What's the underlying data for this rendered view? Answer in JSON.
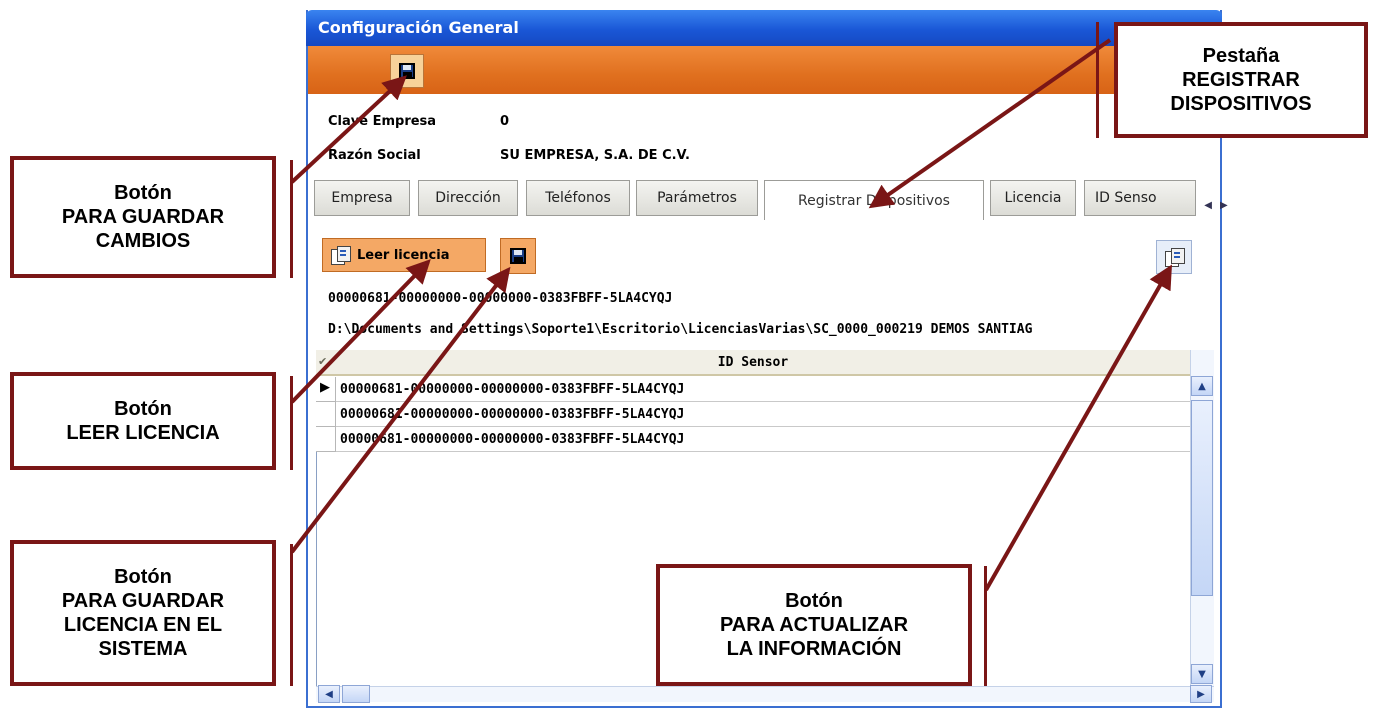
{
  "window": {
    "title": "Configuración General"
  },
  "toolbar": {
    "save_icon": "floppy-disk-icon"
  },
  "company": {
    "clave_label": "Clave Empresa",
    "clave_value": "0",
    "razon_label": "Razón Social",
    "razon_value": "SU EMPRESA, S.A. DE C.V."
  },
  "tabs": [
    {
      "label": "Empresa"
    },
    {
      "label": "Dirección"
    },
    {
      "label": "Teléfonos"
    },
    {
      "label": "Parámetros"
    },
    {
      "label": "Registrar Dispositivos"
    },
    {
      "label": "Licencia"
    },
    {
      "label": "ID Senso"
    }
  ],
  "actions": {
    "leer_licencia_label": "Leer licencia"
  },
  "license": {
    "key": "00000681-00000000-00000000-0383FBFF-5LA4CYQJ",
    "path": "D:\\Documents and Settings\\Soporte1\\Escritorio\\LicenciasVarias\\SC_0000_000219 DEMOS SANTIAG"
  },
  "grid": {
    "header_marker": "✔",
    "column_header": "ID Sensor",
    "rows": [
      "00000681-00000000-00000000-0383FBFF-5LA4CYQJ",
      "00000681-00000000-00000000-0383FBFF-5LA4CYQJ",
      "00000681-00000000-00000000-0383FBFF-5LA4CYQJ"
    ]
  },
  "callouts": {
    "guardar_cambios": [
      "Botón",
      "PARA GUARDAR",
      "CAMBIOS"
    ],
    "leer_licencia": [
      "Botón",
      "LEER LICENCIA"
    ],
    "guardar_licencia": [
      "Botón",
      "PARA GUARDAR",
      "LICENCIA EN EL",
      "SISTEMA"
    ],
    "pestana": [
      "Pestaña",
      "REGISTRAR",
      "DISPOSITIVOS"
    ],
    "actualizar": [
      "Botón",
      "PARA ACTUALIZAR",
      "LA INFORMACIÓN"
    ]
  },
  "colors": {
    "callout_border": "#7a1616",
    "titlebar": "#1a57d6",
    "toolbar": "#e0701f"
  }
}
